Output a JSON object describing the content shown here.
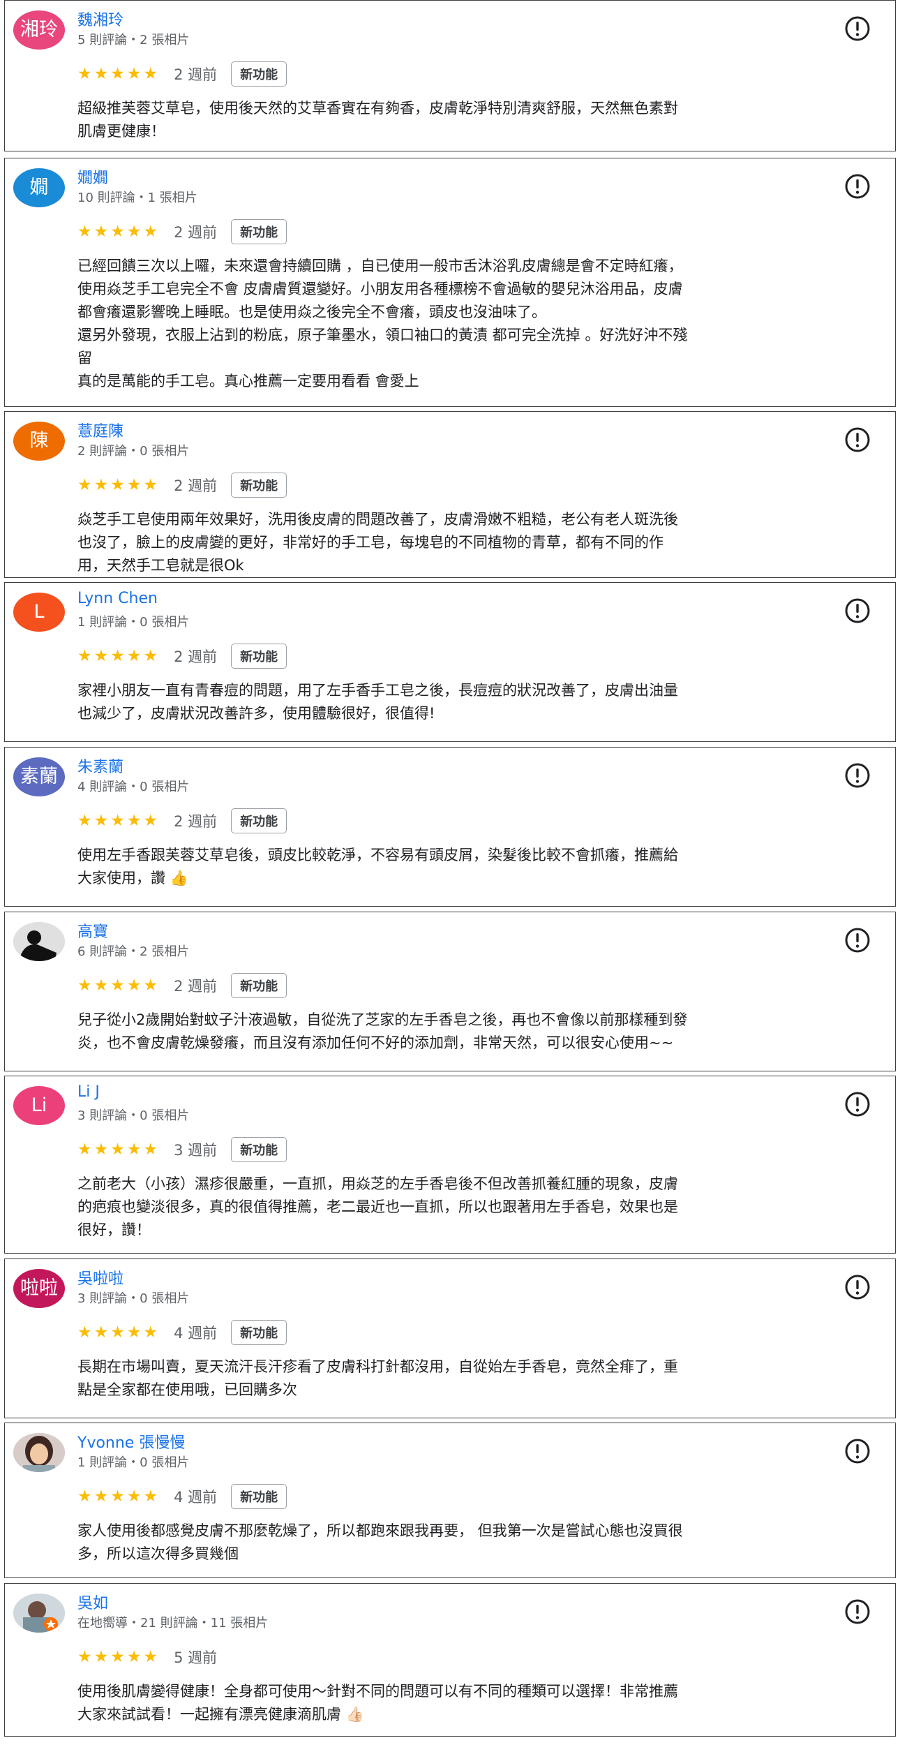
{
  "new_feature_label": "新功能",
  "star_glyphs": "★★★★★",
  "colors": {
    "name_link": "#1a73e8",
    "star": "#fbbc04",
    "border": "#3c4043"
  },
  "reviews": [
    {
      "avatar_text": "湘玲",
      "avatar_color": "#e8467c",
      "name": "魏湘玲",
      "meta": "5 則評論・2 張相片",
      "rating": 5,
      "time": "2 週前",
      "badge": true,
      "text": "超級推芙蓉艾草皂，使用後天然的艾草香實在有夠香，皮膚乾淨特別清爽舒服，天然無色素對\n肌膚更健康！"
    },
    {
      "avatar_text": "嫺",
      "avatar_color": "#1a8bd6",
      "name": "嫺嫺",
      "meta": "10 則評論・1 張相片",
      "rating": 5,
      "time": "2 週前",
      "badge": true,
      "text": "已經回饋三次以上囉，未來還會持續回購 ，自已使用一般市舌沐浴乳皮膚總是會不定時紅癢，\n使用焱芝手工皂完全不會 皮膚膚質還變好。小朋友用各種標榜不會過敏的嬰兒沐浴用品，皮膚\n都會癢還影響晚上睡眠。也是使用焱之後完全不會癢，頭皮也沒油味了。\n還另外發現，衣服上沾到的粉底，原子筆墨水，領口袖口的黃漬 都可完全洗掉 。好洗好沖不殘\n留\n真的是萬能的手工皂。真心推薦一定要用看看 會愛上"
    },
    {
      "avatar_text": "陳",
      "avatar_color": "#ef6c00",
      "name": "薏庭陳",
      "meta": "2 則評論・0 張相片",
      "rating": 5,
      "time": "2 週前",
      "badge": true,
      "text": "焱芝手工皂使用兩年效果好，洗用後皮膚的問題改善了，皮膚滑嫩不粗糙，老公有老人斑洗後\n也沒了，臉上的皮膚變的更好，非常好的手工皂，每塊皂的不同植物的青草，都有不同的作\n用，天然手工皂就是很Ok"
    },
    {
      "avatar_text": "L",
      "avatar_color": "#f4511e",
      "name": "Lynn Chen",
      "meta": "1 則評論・0 張相片",
      "rating": 5,
      "time": "2 週前",
      "badge": true,
      "text": "家裡小朋友一直有青春痘的問題，用了左手香手工皂之後，長痘痘的狀況改善了，皮膚出油量\n也減少了，皮膚狀況改善許多，使用體驗很好，很值得!"
    },
    {
      "avatar_text": "素蘭",
      "avatar_color": "#5c6bc0",
      "name": "朱素蘭",
      "meta": "4 則評論・0 張相片",
      "rating": 5,
      "time": "2 週前",
      "badge": true,
      "text": "使用左手香跟芙蓉艾草皂後，頭皮比較乾淨，不容易有頭皮屑，染髮後比較不會抓癢，推薦給\n大家使用，讚 👍"
    },
    {
      "avatar_text": "",
      "avatar_color": "#e0e0e0",
      "avatar_photo": "silhouette",
      "name": "高寶",
      "meta": "6 則評論・2 張相片",
      "rating": 5,
      "time": "2 週前",
      "badge": true,
      "text": "兒子從小2歲開始對蚊子汁液過敏，自從洗了芝家的左手香皂之後，再也不會像以前那樣種到發\n炎，也不會皮膚乾燥發癢，而且沒有添加任何不好的添加劑，非常天然，可以很安心使用~~"
    },
    {
      "avatar_text": "Li",
      "avatar_color": "#ec407a",
      "name": "Li J",
      "meta": "3 則評論・0 張相片",
      "rating": 5,
      "time": "3 週前",
      "badge": true,
      "text": "之前老大（小孩）濕疹很嚴重，一直抓，用焱芝的左手香皂後不但改善抓養紅腫的現象，皮膚\n的疤痕也變淡很多，真的很值得推薦，老二最近也一直抓，所以也跟著用左手香皂，效果也是\n很好，讚！"
    },
    {
      "avatar_text": "啦啦",
      "avatar_color": "#c2185b",
      "name": "吳啦啦",
      "meta": "3 則評論・0 張相片",
      "rating": 5,
      "time": "4 週前",
      "badge": true,
      "text": "長期在市場叫賣，夏天流汗長汗疹看了皮膚科打針都沒用，自從始左手香皂，竟然全痱了，重\n點是全家都在使用哦，已回購多次"
    },
    {
      "avatar_text": "",
      "avatar_color": "#d7ccc8",
      "avatar_photo": "face",
      "name": "Yvonne 張慢慢",
      "meta": "1 則評論・0 張相片",
      "rating": 5,
      "time": "4 週前",
      "badge": true,
      "text": "家人使用後都感覺皮膚不那麼乾燥了，所以都跑來跟我再要， 但我第一次是嘗試心態也沒買很\n多，所以這次得多買幾個"
    },
    {
      "avatar_text": "",
      "avatar_color": "#cfd8dc",
      "avatar_photo": "guide",
      "name": "吳如",
      "meta": "在地嚮導・21 則評論・11 張相片",
      "rating": 5,
      "time": "5 週前",
      "badge": false,
      "text": "使用後肌膚變得健康！全身都可使用～針對不同的問題可以有不同的種類可以選擇！非常推薦\n大家來試試看！一起擁有漂亮健康滴肌膚 👍🏻"
    }
  ]
}
